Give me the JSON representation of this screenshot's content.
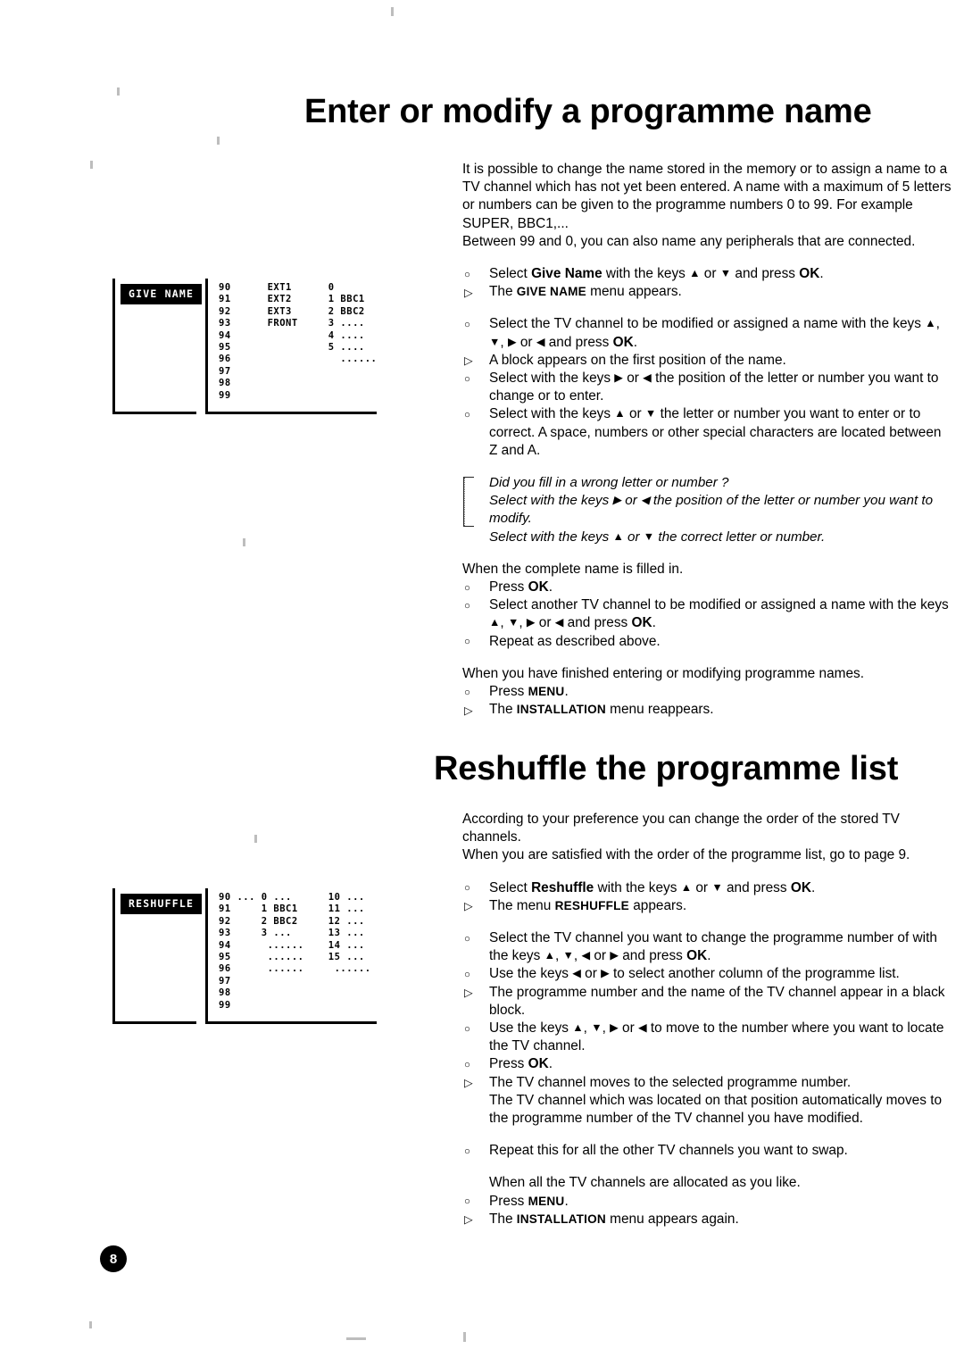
{
  "page": {
    "number": "8"
  },
  "sections": [
    {
      "heading": "Enter or modify a programme name",
      "intro": [
        "It is possible to change the name stored in the memory or to assign a name to a TV channel which has not yet been entered. A name with a maximum of 5 letters or numbers can be given to the programme numbers 0 to 99. For example SUPER, BBC1,...",
        "Between 99 and 0, you can also name any peripherals that are connected."
      ]
    },
    {
      "heading": "Reshuffle the programme list",
      "intro": [
        "According to your preference you can change the order of the stored TV channels.",
        "When you are satisfied with the order of the programme list, go to page 9."
      ]
    }
  ],
  "give_name": {
    "heading": "Enter or modify a programme name",
    "intro_1": "It is possible to change the name stored in the memory or to assign a name to a TV channel which has not yet been entered. A name with a maximum of 5 letters or numbers can be given to the programme numbers 0 to 99. For example SUPER, BBC1,...",
    "intro_2": "Between 99 and 0, you can also name any peripherals that are connected.",
    "steps_group_1": [
      {
        "marker": "circle",
        "html": "Select <b>Give Name</b> with the keys <span class=\"arrowkey\">▲</span> or <span class=\"arrowkey\">▼</span> and press <b>OK</b>."
      },
      {
        "marker": "triangle",
        "html": "The <span class=\"smallcaps\">GIVE NAME</span> menu appears."
      }
    ],
    "steps_group_2": [
      {
        "marker": "circle",
        "html": "Select the TV channel to be modified or assigned a name with the keys <span class=\"arrowkey\">▲</span>, <span class=\"arrowkey\">▼</span>, <span class=\"arrowkey\">▶</span> or <span class=\"arrowkey\">◀</span> and press <b>OK</b>."
      },
      {
        "marker": "triangle",
        "html": "A block appears on the first position of the name."
      },
      {
        "marker": "circle",
        "html": "Select with the keys <span class=\"arrowkey\">▶</span> or <span class=\"arrowkey\">◀</span> the position of the letter or number you want to change or to enter."
      },
      {
        "marker": "circle",
        "html": "Select with the keys <span class=\"arrowkey\">▲</span> or <span class=\"arrowkey\">▼</span> the letter or number you want to enter or to correct. A space, numbers or other special characters are located between Z and A."
      }
    ],
    "note": [
      "Did you fill in a wrong letter or number ?",
      "Select with the keys ▶ or ◀ the position of the letter or number you want to modify.",
      "Select with the keys ▲ or ▼ the correct letter or number."
    ],
    "note_html": [
      "Did you fill in a wrong letter or number ?",
      "Select with the keys <span class=\"arrowkey\">▶</span> or <span class=\"arrowkey\">◀</span> the position of the letter or number you want to modify.",
      "Select with the keys <span class=\"arrowkey\">▲</span> or <span class=\"arrowkey\">▼</span> the correct letter or number."
    ],
    "lead_in_1": "When the complete name is filled in.",
    "steps_group_3": [
      {
        "marker": "circle",
        "html": "Press <b>OK</b>."
      },
      {
        "marker": "circle",
        "html": "Select another TV channel to be modified or assigned a name with the keys <span class=\"arrowkey\">▲</span>, <span class=\"arrowkey\">▼</span>, <span class=\"arrowkey\">▶</span> or <span class=\"arrowkey\">◀</span> and press <b>OK</b>."
      },
      {
        "marker": "circle",
        "html": "Repeat as described above."
      }
    ],
    "lead_in_2": "When you have finished entering or modifying programme names.",
    "steps_group_4": [
      {
        "marker": "circle",
        "html": "Press <span class=\"smallcaps\">MENU</span>."
      },
      {
        "marker": "triangle",
        "html": "The <span class=\"smallcaps\">INSTALLATION</span> menu reappears."
      }
    ]
  },
  "reshuffle": {
    "heading": "Reshuffle the programme list",
    "intro_1": "According to your preference you can change the order of the stored TV channels.",
    "intro_2": "When you are satisfied with the order of the programme list, go to page 9.",
    "steps_group_1": [
      {
        "marker": "circle",
        "html": "Select <b>Reshuffle</b> with the keys <span class=\"arrowkey\">▲</span> or <span class=\"arrowkey\">▼</span> and press <b>OK</b>."
      },
      {
        "marker": "triangle",
        "html": "The menu <span class=\"smallcaps\">RESHUFFLE</span> appears."
      }
    ],
    "steps_group_2": [
      {
        "marker": "circle",
        "html": "Select the TV channel you want to change the programme number of with the keys <span class=\"arrowkey\">▲</span>, <span class=\"arrowkey\">▼</span>, <span class=\"arrowkey\">◀</span> or <span class=\"arrowkey\">▶</span> and press <b>OK</b>."
      },
      {
        "marker": "circle",
        "html": "Use the keys <span class=\"arrowkey\">◀</span> or <span class=\"arrowkey\">▶</span> to select another column of the programme list."
      },
      {
        "marker": "triangle",
        "html": "The programme number and the name of the TV channel appear in a black block."
      },
      {
        "marker": "circle",
        "html": "Use the keys <span class=\"arrowkey\">▲</span>, <span class=\"arrowkey\">▼</span>, <span class=\"arrowkey\">▶</span> or <span class=\"arrowkey\">◀</span> to move to the number where you want to locate the TV channel."
      },
      {
        "marker": "circle",
        "html": "Press <b>OK</b>."
      },
      {
        "marker": "triangle",
        "html": "The TV channel moves to the selected programme number."
      }
    ],
    "continuation": "The TV channel which was located on that position automatically moves to the programme number of the TV channel you have modified.",
    "steps_group_3": [
      {
        "marker": "circle",
        "html": "Repeat this for all the other TV channels you want to swap."
      }
    ],
    "lead_in_1": "When all the TV channels are allocated as you like.",
    "steps_group_4": [
      {
        "marker": "circle",
        "html": "Press <span class=\"smallcaps\">MENU</span>."
      },
      {
        "marker": "triangle",
        "html": "The <span class=\"smallcaps\">INSTALLATION</span> menu appears again."
      }
    ]
  },
  "figure_give_name": {
    "menu_label": "GIVE NAME",
    "rows": [
      "90      EXT1      0",
      "91      EXT2      1 BBC1",
      "92      EXT3      2 BBC2",
      "93      FRONT     3 ....",
      "94                4 ....",
      "95                5 ....",
      "96                  ......",
      "97",
      "98",
      "99"
    ]
  },
  "figure_reshuffle": {
    "menu_label": "RESHUFFLE",
    "rows": [
      "90 ... 0 ...      10 ...",
      "91     1 BBC1     11 ...",
      "92     2 BBC2     12 ...",
      "93     3 ...      13 ...",
      "94      ......    14 ...",
      "95      ......    15 ...",
      "96      ......     ......",
      "97",
      "98",
      "99"
    ]
  },
  "markers": {
    "circle": "○",
    "triangle": "▷"
  }
}
